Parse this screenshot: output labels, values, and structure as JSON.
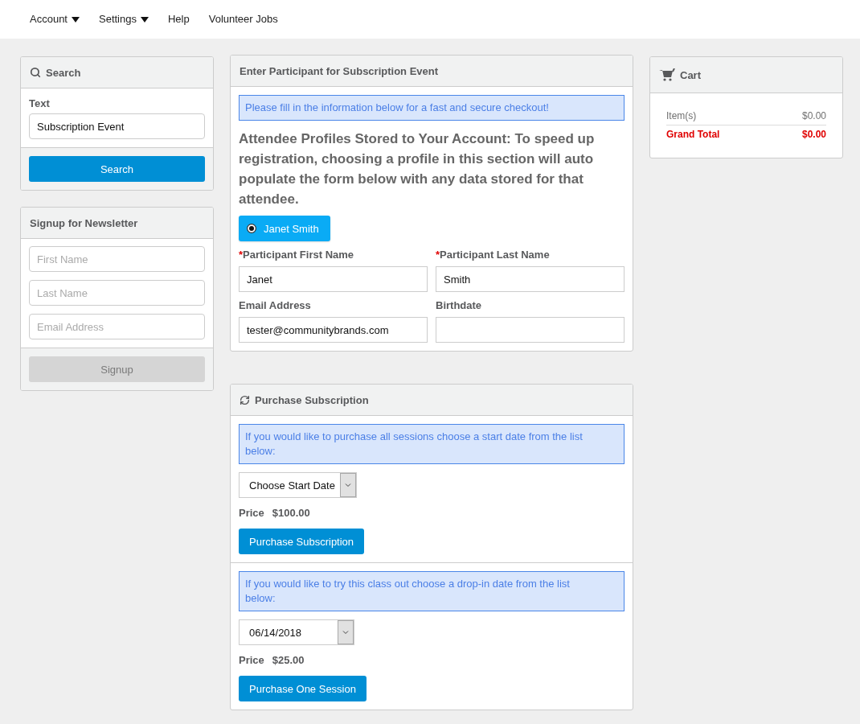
{
  "nav": [
    {
      "label": "Account",
      "dropdown": true
    },
    {
      "label": "Settings",
      "dropdown": true
    },
    {
      "label": "Help",
      "dropdown": false
    },
    {
      "label": "Volunteer Jobs",
      "dropdown": false
    }
  ],
  "search_panel": {
    "title": "Search",
    "field_label": "Text",
    "value": "Subscription Event",
    "button": "Search"
  },
  "newsletter_panel": {
    "title": "Signup for Newsletter",
    "fields": [
      {
        "placeholder": "First Name"
      },
      {
        "placeholder": "Last Name"
      },
      {
        "placeholder": "Email Address"
      }
    ],
    "button": {
      "label": "Signup",
      "disabled": true
    }
  },
  "participant_panel": {
    "title": "Enter Participant for Subscription Event",
    "notice": "Please fill in the information below for a fast and secure checkout!",
    "profiles_heading": "Attendee Profiles Stored to Your Account: To speed up registration, choosing a profile in this section will auto populate the form below with any data stored for that attendee.",
    "profiles": [
      {
        "label": "Janet Smith",
        "selected": true
      }
    ],
    "fields": [
      {
        "required_mark": "*",
        "label": "Participant First Name",
        "value": "Janet"
      },
      {
        "required_mark": "*",
        "label": "Participant Last Name",
        "value": "Smith"
      },
      {
        "label": "Email Address",
        "value": "tester@communitybrands.com"
      },
      {
        "label": "Birthdate"
      }
    ]
  },
  "purchase_panel": {
    "title": "Purchase Subscription",
    "options": [
      {
        "notice": "If you would like to purchase all sessions choose a start date from the list below:",
        "select": "Choose Start Date",
        "price_label": "Price",
        "price": "$100.00",
        "button": "Purchase Subscription"
      },
      {
        "notice": "If you would like to try this class out choose a drop-in date from the list below:",
        "select": "06/14/2018",
        "price_label": "Price",
        "price": "$25.00",
        "button": "Purchase One Session"
      }
    ]
  },
  "cart": {
    "title": "Cart",
    "lines": [
      {
        "kind": "subtotal",
        "label": "Item(s)",
        "amount": "$0.00"
      },
      {
        "kind": "total",
        "label": "Grand Total",
        "amount": "$0.00"
      }
    ]
  }
}
